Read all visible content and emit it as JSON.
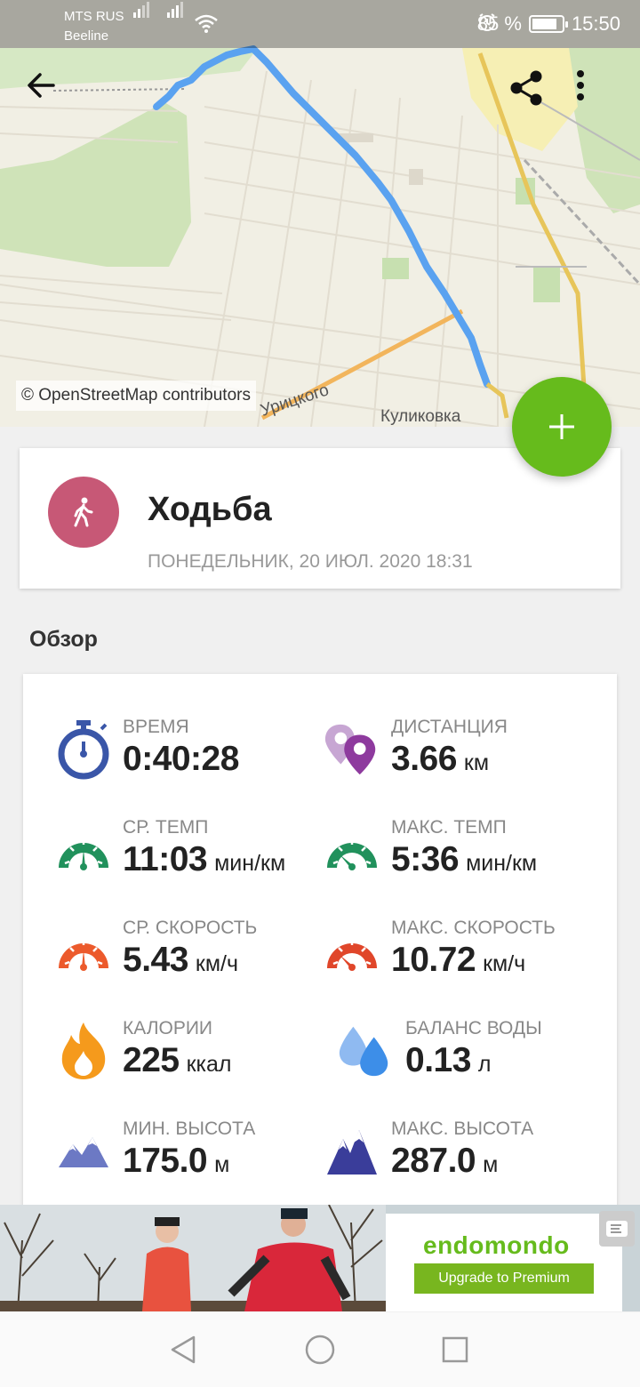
{
  "status_bar": {
    "carrier_1": "MTS RUS",
    "carrier_2": "Beeline",
    "battery_percent": "85 %",
    "battery_level": 0.85,
    "time": "15:50"
  },
  "map": {
    "attribution": "© OpenStreetMap contributors",
    "street_label": "Урицкого",
    "district_label": "Куликовка",
    "route_color": "#5aa2f0"
  },
  "toolbar": {
    "back_icon": "arrow-left-icon",
    "share_icon": "share-icon",
    "menu_icon": "more-vert-icon"
  },
  "fab": {
    "icon": "plus-icon",
    "color": "#66bb1c"
  },
  "workout": {
    "sport": "Ходьба",
    "sport_icon": "walking-icon",
    "sport_color": "#c75876",
    "date": "ПОНЕДЕЛЬНИК, 20 ИЮЛ. 2020 18:31"
  },
  "overview": {
    "title": "Обзор",
    "stats": [
      {
        "label": "ВРЕМЯ",
        "value": "0:40:28",
        "unit": "",
        "icon": "stopwatch-icon",
        "color": "#3a56a8"
      },
      {
        "label": "ДИСТАНЦИЯ",
        "value": "3.66",
        "unit": "км",
        "icon": "location-pins-icon",
        "color": "#8e3a9e"
      },
      {
        "label": "СР. ТЕМП",
        "value": "11:03",
        "unit": "мин/км",
        "icon": "gauge-icon",
        "color": "#21915c"
      },
      {
        "label": "МАКС. ТЕМП",
        "value": "5:36",
        "unit": "мин/км",
        "icon": "gauge-icon",
        "color": "#21915c"
      },
      {
        "label": "СР. СКОРОСТЬ",
        "value": "5.43",
        "unit": "км/ч",
        "icon": "gauge-icon",
        "color": "#ec5a2c"
      },
      {
        "label": "МАКС. СКОРОСТЬ",
        "value": "10.72",
        "unit": "км/ч",
        "icon": "gauge-icon",
        "color": "#e0462a"
      },
      {
        "label": "КАЛОРИИ",
        "value": "225",
        "unit": "ккал",
        "icon": "flame-icon",
        "color": "#f59a1c"
      },
      {
        "label": "БАЛАНС ВОДЫ",
        "value": "0.13",
        "unit": "л",
        "icon": "water-drops-icon",
        "color": "#3d8ee8"
      },
      {
        "label": "МИН. ВЫСОТА",
        "value": "175.0",
        "unit": "м",
        "icon": "mountain-icon",
        "color": "#6c79c4"
      },
      {
        "label": "МАКС. ВЫСОТА",
        "value": "287.0",
        "unit": "м",
        "icon": "mountain-icon",
        "color": "#3a3d9a"
      }
    ]
  },
  "ad": {
    "logo": "endomondo",
    "button": "Upgrade to Premium"
  },
  "navbar": {
    "back_icon": "triangle-back-icon",
    "home_icon": "circle-home-icon",
    "recents_icon": "square-recents-icon"
  }
}
